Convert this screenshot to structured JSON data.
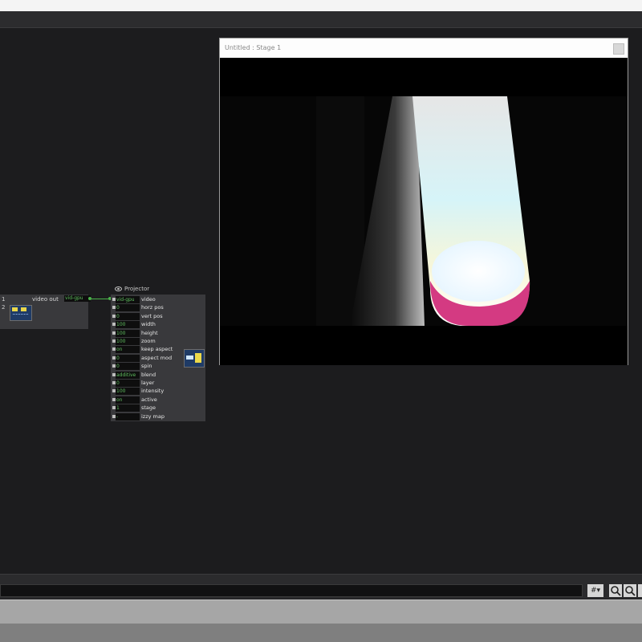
{
  "left_actor": {
    "rows": [
      "1",
      "2"
    ],
    "output_label": "video out",
    "output_value": "vid-gpu"
  },
  "projector": {
    "title": "Projector",
    "properties": [
      {
        "value": "vid-gpu",
        "name": "video"
      },
      {
        "value": "0",
        "name": "horz pos"
      },
      {
        "value": "0",
        "name": "vert pos"
      },
      {
        "value": "100",
        "name": "width"
      },
      {
        "value": "100",
        "name": "height"
      },
      {
        "value": "100",
        "name": "zoom"
      },
      {
        "value": "on",
        "name": "keep aspect"
      },
      {
        "value": "0",
        "name": "aspect mod"
      },
      {
        "value": "0",
        "name": "spin"
      },
      {
        "value": "additive",
        "name": "blend"
      },
      {
        "value": "0",
        "name": "layer"
      },
      {
        "value": "100",
        "name": "intensity"
      },
      {
        "value": "on",
        "name": "active"
      },
      {
        "value": "1",
        "name": "stage"
      },
      {
        "value": "-",
        "name": "izzy map"
      }
    ]
  },
  "stage_window": {
    "title": "Untitled : Stage 1"
  },
  "bottom": {
    "grid_button": "#▾",
    "zoom_in_icon": "zoom-in-icon",
    "zoom_out_icon": "zoom-out-icon"
  }
}
